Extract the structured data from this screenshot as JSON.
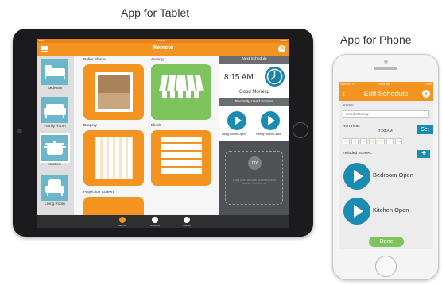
{
  "captions": {
    "tablet": "App for Tablet",
    "phone": "App for Phone"
  },
  "colors": {
    "accent_orange": "#f39320",
    "accent_blue": "#1a8cb4",
    "room_tile_blue": "#6cb6cc",
    "awning_green": "#7dc45c",
    "done_green": "#7dc45c"
  },
  "tablet": {
    "status": {
      "left": "iPad",
      "time": "4:16 PM",
      "right": "100%"
    },
    "nav": {
      "title": "Remote",
      "menu_icon": "hamburger-icon",
      "close_icon": "close-icon"
    },
    "rooms": [
      {
        "label": "Bedroom",
        "icon": "bed-icon",
        "selected": false
      },
      {
        "label": "Family Room",
        "icon": "sofa-icon",
        "selected": false
      },
      {
        "label": "Kitchen",
        "icon": "pot-icon",
        "selected": true
      },
      {
        "label": "Living Room",
        "icon": "armchair-icon",
        "selected": false
      }
    ],
    "scenes": [
      {
        "label": "Roller Shade",
        "icon": "roller-shade-icon"
      },
      {
        "label": "Awning",
        "icon": "awning-icon"
      },
      {
        "label": "Drapery",
        "icon": "drapery-icon"
      },
      {
        "label": "Blinds",
        "icon": "blinds-icon"
      },
      {
        "label": "Projection Screen",
        "icon": "projection-screen-icon"
      }
    ],
    "next_schedule": {
      "header": "Next Schedule",
      "time": "8:15 AM",
      "name": "Good Morning"
    },
    "recent": {
      "header": "Recently Used Scenes",
      "items": [
        {
          "label": "Living Room Open"
        },
        {
          "label": "Family Room Close"
        }
      ]
    },
    "my_scenes": {
      "badge": "my",
      "hint": "Drag your favorite scene here to create new scene"
    },
    "tabs": [
      {
        "label": "Remote",
        "icon": "remote-icon",
        "active": true
      },
      {
        "label": "Schedule",
        "icon": "clock-icon",
        "active": false
      },
      {
        "label": "Scenes",
        "icon": "play-icon",
        "active": false
      }
    ]
  },
  "phone": {
    "status": {
      "left": "Verizon LTE",
      "time": "10:01 AM",
      "right": "100%"
    },
    "nav": {
      "title": "Edit Schedule",
      "back_icon": "chevron-left-icon",
      "add_icon": "plus-circle-icon"
    },
    "name_label": "Name:",
    "name_value": "Good Morning",
    "run_time_label": "Run Time:",
    "run_time_value": "7:00 AM",
    "set_button": "Set",
    "days": [
      {
        "label": "Su",
        "on": false
      },
      {
        "label": "M",
        "on": true
      },
      {
        "label": "Tu",
        "on": true
      },
      {
        "label": "W",
        "on": true
      },
      {
        "label": "Th",
        "on": true
      },
      {
        "label": "F",
        "on": true
      },
      {
        "label": "Sa",
        "on": false
      }
    ],
    "included_label": "Included Scenes:",
    "add_button": "+",
    "scenes": [
      {
        "label": "Bedroom Open"
      },
      {
        "label": "Kitchen Open"
      }
    ],
    "done_button": "Done"
  }
}
